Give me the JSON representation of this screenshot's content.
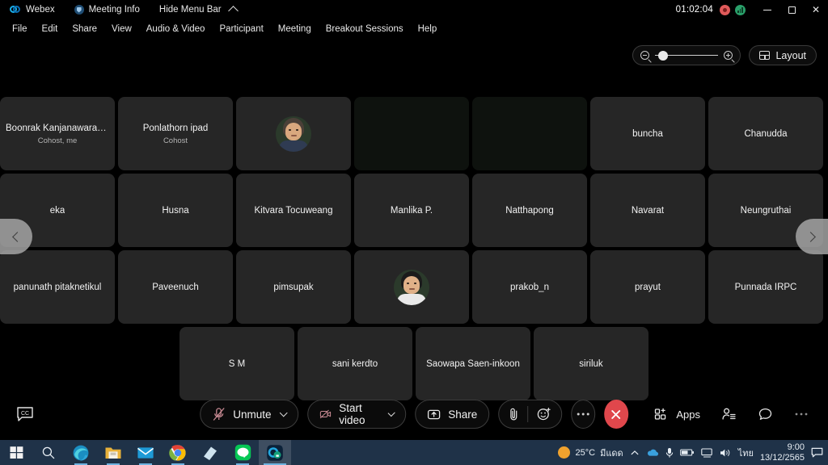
{
  "titlebar": {
    "app_name": "Webex",
    "meeting_info": "Meeting Info",
    "hide_menu_bar": "Hide Menu Bar",
    "timer": "01:02:04",
    "recording_icon": "record-icon",
    "network_icon": "network-quality-icon",
    "minimize": "minimize-button",
    "maximize": "maximize-button",
    "close": "close-button"
  },
  "menubar": {
    "items": [
      {
        "label": "File"
      },
      {
        "label": "Edit"
      },
      {
        "label": "Share"
      },
      {
        "label": "View"
      },
      {
        "label": "Audio & Video"
      },
      {
        "label": "Participant"
      },
      {
        "label": "Meeting"
      },
      {
        "label": "Breakout Sessions"
      },
      {
        "label": "Help"
      }
    ]
  },
  "top_controls": {
    "zoom_out_icon": "zoom-out-icon",
    "zoom_in_icon": "zoom-in-icon",
    "layout_label": "Layout",
    "layout_icon": "grid-layout-icon"
  },
  "grid": {
    "rows": [
      [
        {
          "name": "Boonrak Kanjanawarawa…",
          "role": "Cohost, me",
          "kind": "name"
        },
        {
          "name": "Ponlathorn ipad",
          "role": "Cohost",
          "kind": "name"
        },
        {
          "name": "",
          "role": "",
          "kind": "avatar-female"
        },
        {
          "name": "",
          "role": "",
          "kind": "video-dark"
        },
        {
          "name": "",
          "role": "",
          "kind": "video-dark"
        },
        {
          "name": "buncha",
          "role": "",
          "kind": "name"
        },
        {
          "name": "Chanudda",
          "role": "",
          "kind": "name"
        }
      ],
      [
        {
          "name": "eka",
          "role": "",
          "kind": "name"
        },
        {
          "name": "Husna",
          "role": "",
          "kind": "name"
        },
        {
          "name": "Kitvara Tocuweang",
          "role": "",
          "kind": "name"
        },
        {
          "name": "Manlika P.",
          "role": "",
          "kind": "name"
        },
        {
          "name": "Natthapong",
          "role": "",
          "kind": "name"
        },
        {
          "name": "Navarat",
          "role": "",
          "kind": "name"
        },
        {
          "name": "Neungruthai",
          "role": "",
          "kind": "name"
        }
      ],
      [
        {
          "name": "panunath pitaknetikul",
          "role": "",
          "kind": "name"
        },
        {
          "name": "Paveenuch",
          "role": "",
          "kind": "name"
        },
        {
          "name": "pimsupak",
          "role": "",
          "kind": "name"
        },
        {
          "name": "",
          "role": "",
          "kind": "avatar-male"
        },
        {
          "name": "prakob_n",
          "role": "",
          "kind": "name"
        },
        {
          "name": "prayut",
          "role": "",
          "kind": "name"
        },
        {
          "name": "Punnada IRPC",
          "role": "",
          "kind": "name"
        }
      ],
      [
        {
          "name": "S M",
          "role": "",
          "kind": "name"
        },
        {
          "name": "sani kerdto",
          "role": "",
          "kind": "name"
        },
        {
          "name": "Saowapa Saen-inkoon",
          "role": "",
          "kind": "name"
        },
        {
          "name": "siriluk",
          "role": "",
          "kind": "name"
        }
      ]
    ],
    "prev_page_icon": "chevron-left-icon",
    "next_page_icon": "chevron-right-icon"
  },
  "toolbar": {
    "cc_icon": "closed-caption-icon",
    "unmute_label": "Unmute",
    "unmute_icon": "microphone-muted-icon",
    "start_video_label": "Start video",
    "start_video_icon": "camera-off-icon",
    "share_label": "Share",
    "share_icon": "share-screen-icon",
    "attach_icon": "paperclip-icon",
    "reactions_icon": "emoji-reaction-icon",
    "more_icon": "more-options-icon",
    "leave_icon": "leave-meeting-icon",
    "apps_label": "Apps",
    "apps_icon": "apps-grid-icon",
    "participants_icon": "participants-icon",
    "chat_icon": "chat-bubble-icon",
    "more_right_icon": "more-options-icon"
  },
  "taskbar": {
    "start_icon": "windows-start-icon",
    "search_icon": "search-icon",
    "apps": [
      {
        "icon": "edge-browser-icon"
      },
      {
        "icon": "file-explorer-icon"
      },
      {
        "icon": "mail-icon"
      },
      {
        "icon": "chrome-browser-icon"
      },
      {
        "icon": "sticky-notes-icon"
      },
      {
        "icon": "line-app-icon"
      },
      {
        "icon": "webex-app-icon"
      }
    ],
    "weather_temp": "25°C",
    "weather_desc": "มีแดด",
    "weather_icon": "sun-icon",
    "tray": {
      "overflow_icon": "chevron-up-icon",
      "onedrive_icon": "onedrive-cloud-icon",
      "mic_icon": "microphone-icon",
      "battery_icon": "battery-icon",
      "network_icon": "network-icon",
      "volume_icon": "speaker-icon",
      "language": "ไทย"
    },
    "time": "9:00",
    "date": "13/12/2565",
    "notification_icon": "notification-icon"
  },
  "colors": {
    "accent_red": "#e0474c",
    "taskbar_blue": "#1f3248",
    "tile_gray": "#262626"
  }
}
